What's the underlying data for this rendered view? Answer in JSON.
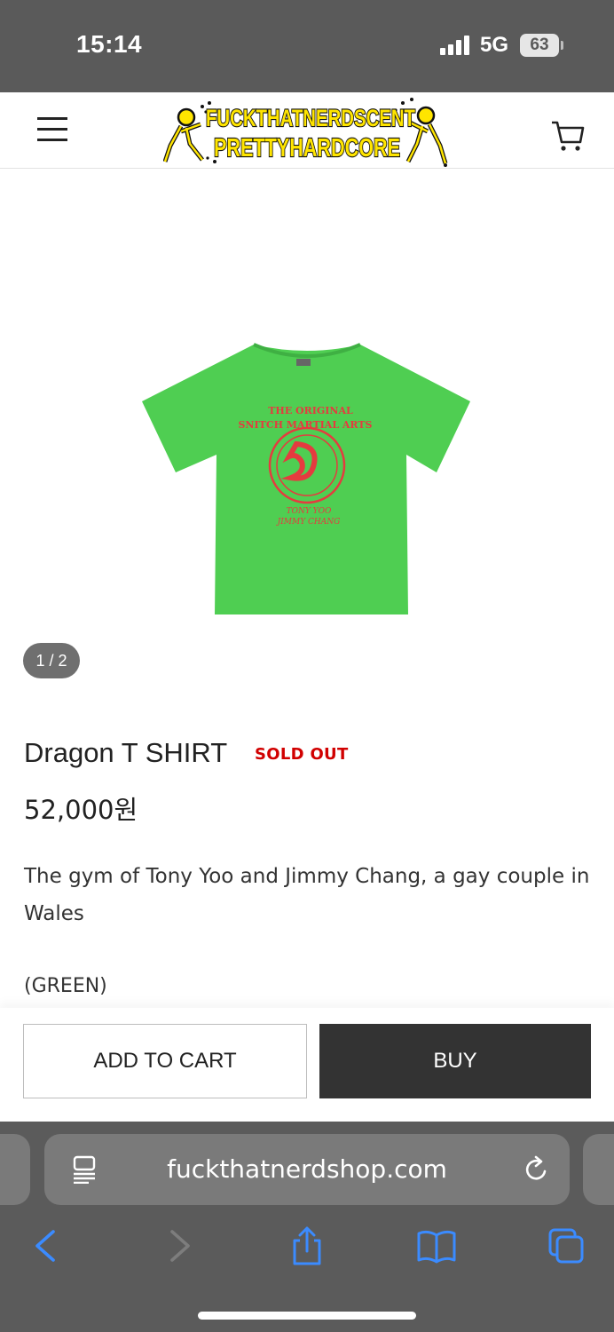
{
  "status_bar": {
    "time": "15:14",
    "network": "5G",
    "battery": "63"
  },
  "header": {
    "logo_line1": "FUCKTHATNERDSCENT",
    "logo_line2": "PRETTYHARDCORE",
    "menu_icon": "hamburger-menu-icon",
    "cart_icon": "shopping-cart-icon"
  },
  "gallery": {
    "counter": "1 / 2",
    "print_line1": "THE ORIGINAL",
    "print_line2": "SNITCH MARTIAL ARTS",
    "print_line3": "TONY YOO",
    "print_line4": "JIMMY CHANG",
    "shirt_color": "#4fce52",
    "print_color": "#e53b3f"
  },
  "product": {
    "name": "Dragon T SHIRT",
    "badge": "SOLD OUT",
    "price": "52,000원",
    "description": "The gym of Tony Yoo and Jimmy Chang, a gay couple in Wales",
    "color_note": "(GREEN)"
  },
  "actions": {
    "add_to_cart": "ADD TO CART",
    "buy": "BUY"
  },
  "browser": {
    "url": "fuckthatnerdshop.com",
    "icons": [
      "reader-icon",
      "reload-icon",
      "back-icon",
      "forward-icon",
      "share-icon",
      "bookmarks-icon",
      "tabs-icon"
    ]
  }
}
